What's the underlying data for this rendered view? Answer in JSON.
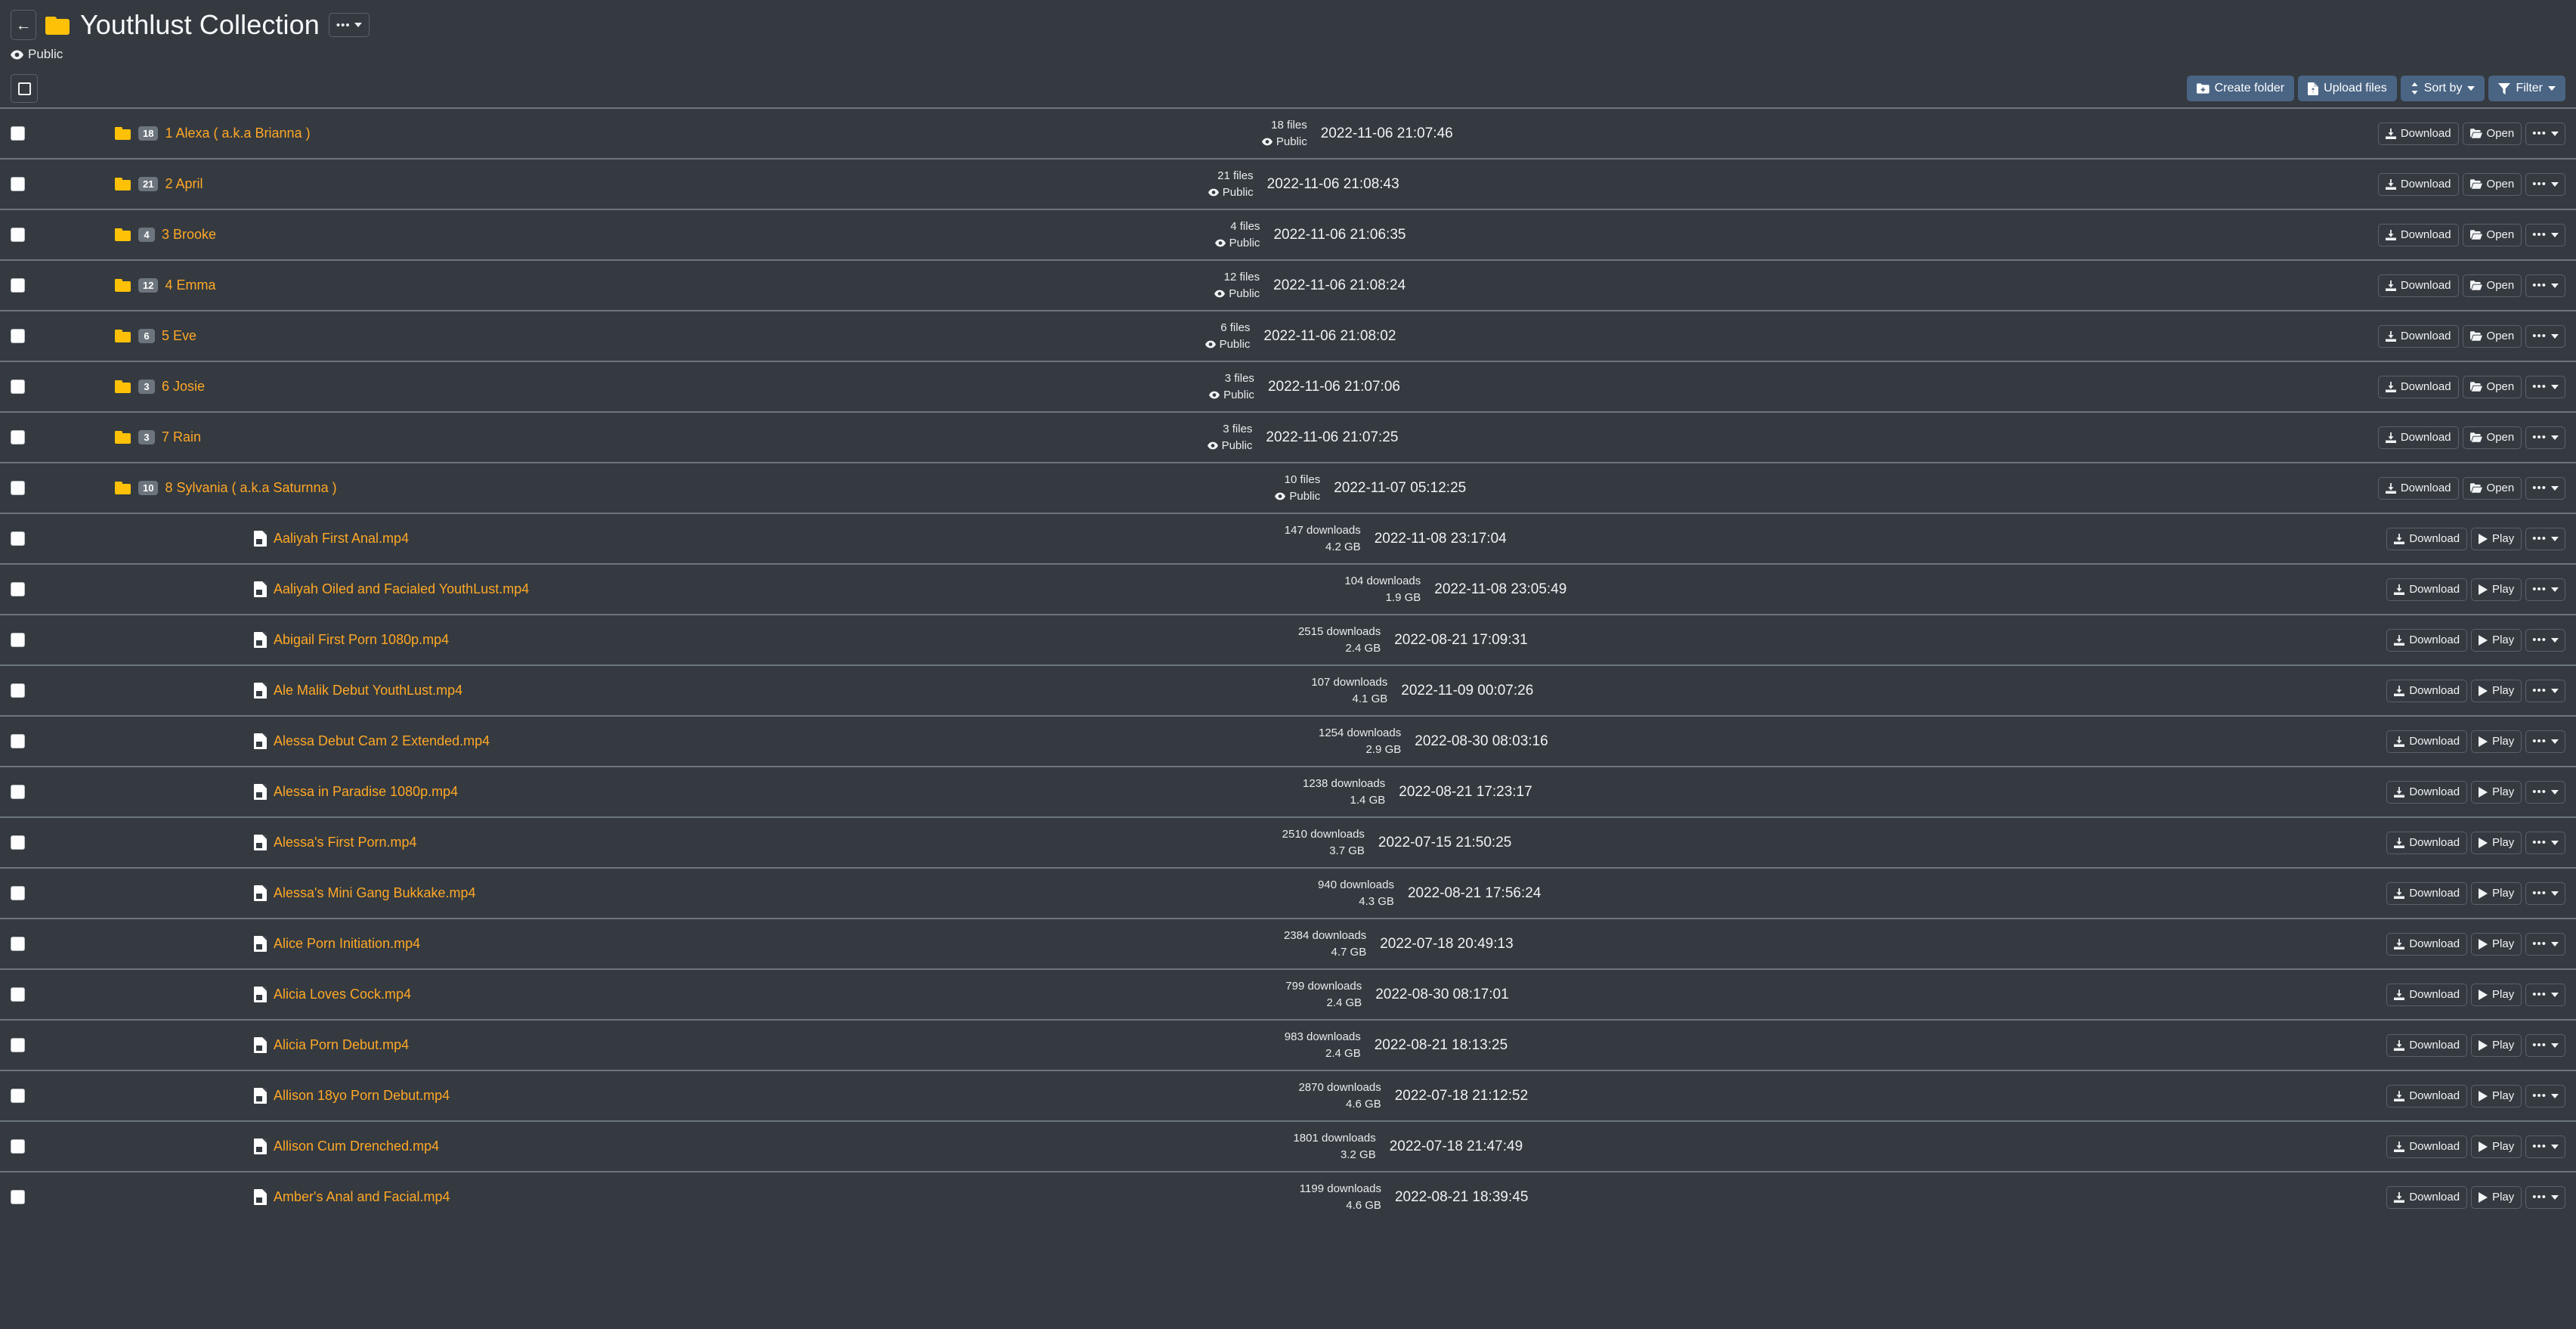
{
  "header": {
    "back_label": "←",
    "folder_icon": "folder-icon",
    "title": "Youthlust Collection",
    "more_menu_label": "•••",
    "visibility": "Public",
    "visibility_icon": "eye-icon"
  },
  "toolbar": {
    "select_all_icon": "checkbox-icon",
    "create_folder_label": "Create folder",
    "upload_files_label": "Upload files",
    "sort_by_label": "Sort by",
    "filter_label": "Filter"
  },
  "actions": {
    "download_label": "Download",
    "open_label": "Open",
    "play_label": "Play",
    "more_label": "•••"
  },
  "colors": {
    "background": "#343a40",
    "row_separator": "#6c757d",
    "link": "#ffa726",
    "folder": "#ffc107",
    "primary_button": "#4a6484",
    "badge": "#6c757d"
  },
  "rows": [
    {
      "type": "folder",
      "name": "1 Alexa ( a.k.a Brianna )",
      "count": "18",
      "meta1": "18 files",
      "meta2": "Public",
      "date": "2022-11-06 21:07:46"
    },
    {
      "type": "folder",
      "name": "2 April",
      "count": "21",
      "meta1": "21 files",
      "meta2": "Public",
      "date": "2022-11-06 21:08:43"
    },
    {
      "type": "folder",
      "name": "3 Brooke",
      "count": "4",
      "meta1": "4 files",
      "meta2": "Public",
      "date": "2022-11-06 21:06:35"
    },
    {
      "type": "folder",
      "name": "4 Emma",
      "count": "12",
      "meta1": "12 files",
      "meta2": "Public",
      "date": "2022-11-06 21:08:24"
    },
    {
      "type": "folder",
      "name": "5 Eve",
      "count": "6",
      "meta1": "6 files",
      "meta2": "Public",
      "date": "2022-11-06 21:08:02"
    },
    {
      "type": "folder",
      "name": "6 Josie",
      "count": "3",
      "meta1": "3 files",
      "meta2": "Public",
      "date": "2022-11-06 21:07:06"
    },
    {
      "type": "folder",
      "name": "7 Rain",
      "count": "3",
      "meta1": "3 files",
      "meta2": "Public",
      "date": "2022-11-06 21:07:25"
    },
    {
      "type": "folder",
      "name": "8 Sylvania ( a.k.a Saturnna )",
      "count": "10",
      "meta1": "10 files",
      "meta2": "Public",
      "date": "2022-11-07 05:12:25"
    },
    {
      "type": "file",
      "name": "Aaliyah First Anal.mp4",
      "meta1": "147 downloads",
      "meta2": "4.2 GB",
      "date": "2022-11-08 23:17:04"
    },
    {
      "type": "file",
      "name": "Aaliyah Oiled and Facialed YouthLust.mp4",
      "meta1": "104 downloads",
      "meta2": "1.9 GB",
      "date": "2022-11-08 23:05:49"
    },
    {
      "type": "file",
      "name": "Abigail First Porn 1080p.mp4",
      "meta1": "2515 downloads",
      "meta2": "2.4 GB",
      "date": "2022-08-21 17:09:31"
    },
    {
      "type": "file",
      "name": "Ale Malik Debut YouthLust.mp4",
      "meta1": "107 downloads",
      "meta2": "4.1 GB",
      "date": "2022-11-09 00:07:26"
    },
    {
      "type": "file",
      "name": "Alessa Debut Cam 2 Extended.mp4",
      "meta1": "1254 downloads",
      "meta2": "2.9 GB",
      "date": "2022-08-30 08:03:16"
    },
    {
      "type": "file",
      "name": "Alessa in Paradise 1080p.mp4",
      "meta1": "1238 downloads",
      "meta2": "1.4 GB",
      "date": "2022-08-21 17:23:17"
    },
    {
      "type": "file",
      "name": "Alessa's First Porn.mp4",
      "meta1": "2510 downloads",
      "meta2": "3.7 GB",
      "date": "2022-07-15 21:50:25"
    },
    {
      "type": "file",
      "name": "Alessa's Mini Gang Bukkake.mp4",
      "meta1": "940 downloads",
      "meta2": "4.3 GB",
      "date": "2022-08-21 17:56:24"
    },
    {
      "type": "file",
      "name": "Alice Porn Initiation.mp4",
      "meta1": "2384 downloads",
      "meta2": "4.7 GB",
      "date": "2022-07-18 20:49:13"
    },
    {
      "type": "file",
      "name": "Alicia Loves Cock.mp4",
      "meta1": "799 downloads",
      "meta2": "2.4 GB",
      "date": "2022-08-30 08:17:01"
    },
    {
      "type": "file",
      "name": "Alicia Porn Debut.mp4",
      "meta1": "983 downloads",
      "meta2": "2.4 GB",
      "date": "2022-08-21 18:13:25"
    },
    {
      "type": "file",
      "name": "Allison 18yo Porn Debut.mp4",
      "meta1": "2870 downloads",
      "meta2": "4.6 GB",
      "date": "2022-07-18 21:12:52"
    },
    {
      "type": "file",
      "name": "Allison Cum Drenched.mp4",
      "meta1": "1801 downloads",
      "meta2": "3.2 GB",
      "date": "2022-07-18 21:47:49"
    },
    {
      "type": "file",
      "name": "Amber's Anal and Facial.mp4",
      "meta1": "1199 downloads",
      "meta2": "4.6 GB",
      "date": "2022-08-21 18:39:45"
    }
  ]
}
